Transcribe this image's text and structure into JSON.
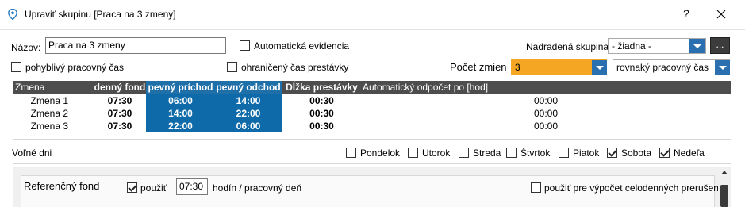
{
  "window": {
    "title": "Upraviť skupinu [Praca na 3 zmeny]",
    "help_label": "?",
    "close_label": "✕"
  },
  "form": {
    "name_label": "Názov:",
    "name_value": "Praca na 3 zmeny",
    "auto_evidence_label": "Automatická evidencia",
    "auto_evidence_checked": false,
    "parent_group_label": "Nadradená skupina:",
    "parent_group_value": "- žiadna -",
    "dots_label": "...",
    "flexible_time_label": "pohyblivý pracovný čas",
    "flexible_time_checked": false,
    "limited_break_label": "ohraničený čas prestávky",
    "limited_break_checked": false,
    "shifts_count_label": "Počet zmien",
    "shifts_count_value": "3",
    "work_time_mode_value": "rovnaký pracovný čas",
    "colors": {
      "accent_orange": "#f5a623",
      "accent_blue": "#0e6aa8"
    }
  },
  "grid": {
    "headers": [
      "Zmena",
      "denný fond",
      "pevný príchod",
      "pevný odchod",
      "Dĺžka prestávky",
      "Automatický odpočet po [hod]"
    ],
    "rows": [
      {
        "shift": "Zmena 1",
        "fund": "07:30",
        "arrival": "06:00",
        "departure": "14:00",
        "break": "00:30",
        "auto": "00:00"
      },
      {
        "shift": "Zmena 2",
        "fund": "07:30",
        "arrival": "14:00",
        "departure": "22:00",
        "break": "00:30",
        "auto": "00:00"
      },
      {
        "shift": "Zmena 3",
        "fund": "07:30",
        "arrival": "22:00",
        "departure": "06:00",
        "break": "00:30",
        "auto": "00:00"
      }
    ]
  },
  "free_days": {
    "label": "Voľné dni",
    "days": [
      {
        "label": "Pondelok",
        "checked": false
      },
      {
        "label": "Utorok",
        "checked": false
      },
      {
        "label": "Streda",
        "checked": false
      },
      {
        "label": "Štvrtok",
        "checked": false
      },
      {
        "label": "Piatok",
        "checked": false
      },
      {
        "label": "Sobota",
        "checked": true
      },
      {
        "label": "Nedeľa",
        "checked": true
      }
    ]
  },
  "reference_fund": {
    "label": "Referenčný fond",
    "use_label": "použiť",
    "use_checked": true,
    "time_value": "07:30",
    "unit_label": "hodín / pracovný deň",
    "interrupt_label": "použiť pre výpočet celodenných prerušení",
    "interrupt_checked": false
  }
}
